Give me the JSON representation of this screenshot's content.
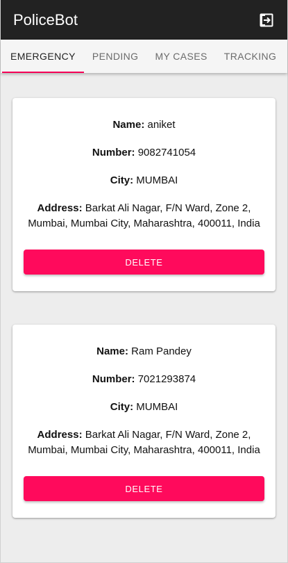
{
  "appbar": {
    "title": "PoliceBot",
    "logout_icon": "logout-icon"
  },
  "tabs": [
    {
      "label": "EMERGENCY",
      "active": true
    },
    {
      "label": "PENDING",
      "active": false
    },
    {
      "label": "MY CASES",
      "active": false
    },
    {
      "label": "TRACKING",
      "active": false
    }
  ],
  "labels": {
    "name": "Name:",
    "number": "Number:",
    "city": "City:",
    "address": "Address:",
    "delete": "DELETE"
  },
  "cards": [
    {
      "name": "aniket",
      "number": "9082741054",
      "city": "MUMBAI",
      "address": "Barkat Ali Nagar, F/N Ward, Zone 2, Mumbai, Mumbai City, Maharashtra, 400011, India"
    },
    {
      "name": "Ram Pandey",
      "number": "7021293874",
      "city": "MUMBAI",
      "address": "Barkat Ali Nagar, F/N Ward, Zone 2, Mumbai, Mumbai City, Maharashtra, 400011, India"
    }
  ],
  "colors": {
    "appbar": "#222222",
    "accent": "#f50057",
    "button": "#ff0a5c"
  }
}
